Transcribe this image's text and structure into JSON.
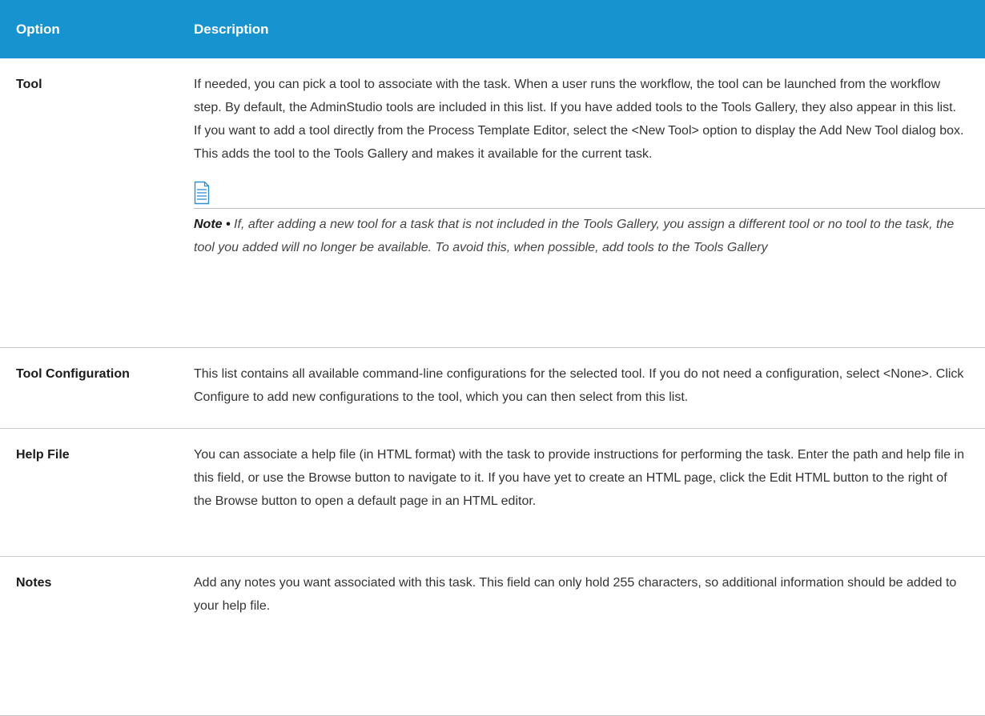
{
  "table": {
    "header": {
      "option": "Option",
      "description": "Description"
    },
    "rows": [
      {
        "option": "Tool",
        "description": "If needed, you can pick a tool to associate with the task. When a user runs the workflow, the tool can be launched from the workflow step. By default, the AdminStudio tools are included in this list. If you have added tools to the Tools Gallery, they also appear in this list. If you want to add a tool directly from the Process Template Editor, select the <New Tool> option to display the Add New Tool dialog box. This adds the tool to the Tools Gallery and makes it available for the current task.",
        "note": {
          "icon": "document-icon",
          "label": "Note •",
          "text": " If, after adding a new tool for a task that is not included in the Tools Gallery, you assign a different tool or no tool to the task, the tool you added will no longer be available. To avoid this, when possible, add tools to the Tools Gallery"
        }
      },
      {
        "option": "Tool Configuration",
        "description": "This list contains all available command-line configurations for the selected tool. If you do not need a configuration, select <None>. Click Configure to add new configurations to the tool, which you can then select from this list."
      },
      {
        "option": "Help File",
        "description": "You can associate a help file (in HTML format) with the task to provide instructions for performing the task. Enter the path and help file in this field, or use the Browse button to navigate to it. If you have yet to create an HTML page, click the Edit HTML button to the right of the Browse button to open a default page in an HTML editor."
      },
      {
        "option": "Notes",
        "description": "Add any notes you want associated with this task. This field can only hold 255 characters, so additional information should be added to your help file."
      }
    ]
  },
  "colors": {
    "header_bg": "#1793d0",
    "header_text": "#ffffff",
    "body_text": "#333333",
    "rule": "#c8c8c8",
    "icon_blue": "#2b8fd6"
  }
}
